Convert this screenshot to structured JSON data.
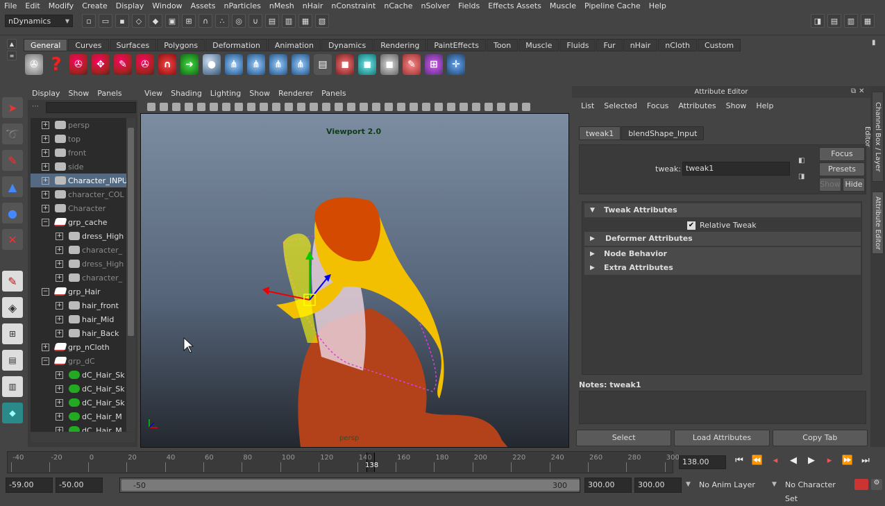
{
  "menubar": [
    "File",
    "Edit",
    "Modify",
    "Create",
    "Display",
    "Window",
    "Assets",
    "nParticles",
    "nMesh",
    "nHair",
    "nConstraint",
    "nCache",
    "nSolver",
    "Fields",
    "Effects Assets",
    "Muscle",
    "Pipeline Cache",
    "Help"
  ],
  "menuset": "nDynamics",
  "shelf_tabs": [
    "General",
    "Curves",
    "Surfaces",
    "Polygons",
    "Deformation",
    "Animation",
    "Dynamics",
    "Rendering",
    "PaintEffects",
    "Toon",
    "Muscle",
    "Fluids",
    "Fur",
    "nHair",
    "nCloth",
    "Custom"
  ],
  "shelf_active": "General",
  "outliner": {
    "menu": [
      "Display",
      "Show",
      "Panels"
    ],
    "items": [
      {
        "label": "persp",
        "dim": true,
        "depth": 0,
        "pm": "+"
      },
      {
        "label": "top",
        "dim": true,
        "depth": 0,
        "pm": "+"
      },
      {
        "label": "front",
        "dim": true,
        "depth": 0,
        "pm": "+"
      },
      {
        "label": "side",
        "dim": true,
        "depth": 0,
        "pm": "+"
      },
      {
        "label": "Character_INPUT",
        "dim": false,
        "depth": 0,
        "pm": "+",
        "sel": true
      },
      {
        "label": "character_COL",
        "dim": true,
        "depth": 0,
        "pm": "+"
      },
      {
        "label": "Character",
        "dim": true,
        "depth": 0,
        "pm": "+"
      },
      {
        "label": "grp_cache",
        "dim": false,
        "depth": 0,
        "pm": "−",
        "grp": true
      },
      {
        "label": "dress_High",
        "dim": false,
        "depth": 1,
        "pm": "+"
      },
      {
        "label": "character_",
        "dim": true,
        "depth": 1,
        "pm": "+"
      },
      {
        "label": "dress_High",
        "dim": true,
        "depth": 1,
        "pm": "+"
      },
      {
        "label": "character_",
        "dim": true,
        "depth": 1,
        "pm": "+"
      },
      {
        "label": "grp_Hair",
        "dim": false,
        "depth": 0,
        "pm": "−",
        "grp": true
      },
      {
        "label": "hair_front",
        "dim": false,
        "depth": 1,
        "pm": "+"
      },
      {
        "label": "hair_Mid",
        "dim": false,
        "depth": 1,
        "pm": "+"
      },
      {
        "label": "hair_Back",
        "dim": false,
        "depth": 1,
        "pm": "+"
      },
      {
        "label": "grp_nCloth",
        "dim": false,
        "depth": 0,
        "pm": "+",
        "grp": true
      },
      {
        "label": "grp_dC",
        "dim": true,
        "depth": 0,
        "pm": "−",
        "grp": true
      },
      {
        "label": "dC_Hair_Sk",
        "dim": false,
        "depth": 1,
        "pm": "+",
        "green": true
      },
      {
        "label": "dC_Hair_Sk",
        "dim": false,
        "depth": 1,
        "pm": "+",
        "green": true
      },
      {
        "label": "dC_Hair_Sk",
        "dim": false,
        "depth": 1,
        "pm": "+",
        "green": true
      },
      {
        "label": "dC_Hair_M",
        "dim": false,
        "depth": 1,
        "pm": "+",
        "green": true
      },
      {
        "label": "dC_Hair_M",
        "dim": false,
        "depth": 1,
        "pm": "+",
        "green": true
      }
    ]
  },
  "viewport": {
    "menu": [
      "View",
      "Shading",
      "Lighting",
      "Show",
      "Renderer",
      "Panels"
    ],
    "label": "Viewport 2.0",
    "camera": "persp"
  },
  "attr": {
    "title": "Attribute Editor",
    "menu": [
      "List",
      "Selected",
      "Focus",
      "Attributes",
      "Show",
      "Help"
    ],
    "tabs": [
      "tweak1",
      "blendShape_Input"
    ],
    "field_label": "tweak:",
    "field_value": "tweak1",
    "focus_label": "Focus",
    "presets_label": "Presets",
    "show_label": "Show",
    "hide_label": "Hide",
    "sections": [
      "Tweak Attributes",
      "Deformer Attributes",
      "Node Behavior",
      "Extra Attributes"
    ],
    "relative_tweak": "Relative Tweak",
    "notes": "Notes:  tweak1",
    "buttons": [
      "Select",
      "Load Attributes",
      "Copy Tab"
    ]
  },
  "side_tabs": [
    "Channel Box / Layer Editor",
    "Attribute Editor"
  ],
  "timeline": {
    "ticks": [
      "-40",
      "-20",
      "0",
      "20",
      "40",
      "60",
      "80",
      "100",
      "120",
      "140",
      "160",
      "180",
      "200",
      "220",
      "240",
      "260",
      "280",
      "300"
    ],
    "current": "138",
    "current_field": "138.00"
  },
  "range": {
    "start_outer": "-59.00",
    "start_inner": "-50.00",
    "slider_start": "-50",
    "slider_end": "300",
    "end_inner": "300.00",
    "end_outer": "300.00",
    "anim_layer": "No Anim Layer",
    "char_set": "No Character Set"
  }
}
